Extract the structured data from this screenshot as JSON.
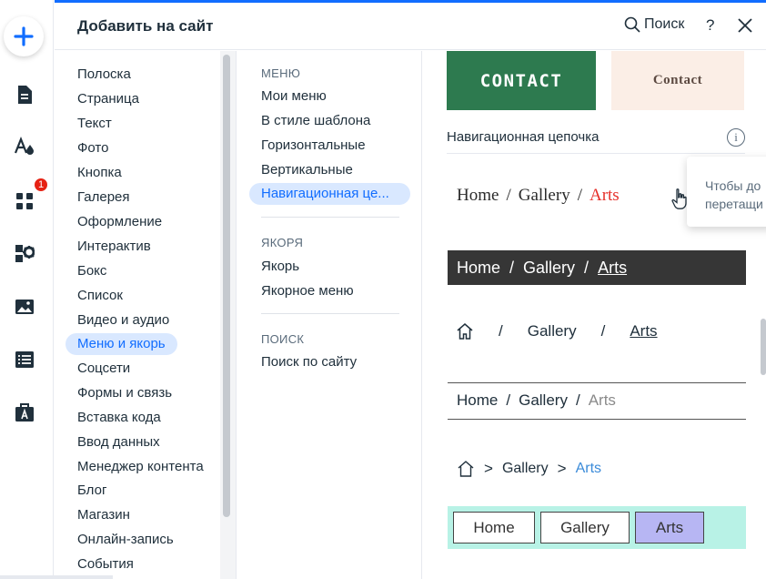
{
  "header": {
    "title": "Добавить на сайт",
    "search_label": "Поиск",
    "help_label": "?"
  },
  "rail": {
    "badge_count": "1",
    "icons": [
      "add-icon",
      "page-icon",
      "design-icon",
      "apps-icon",
      "business-icon",
      "media-icon",
      "table-icon",
      "portfolio-icon"
    ]
  },
  "categories": {
    "items": [
      "Полоска",
      "Страница",
      "Текст",
      "Фото",
      "Кнопка",
      "Галерея",
      "Оформление",
      "Интерактив",
      "Бокс",
      "Список",
      "Видео и аудио",
      "Меню и якорь",
      "Соцсети",
      "Формы и связь",
      "Вставка кода",
      "Ввод данных",
      "Менеджер контента",
      "Блог",
      "Магазин",
      "Онлайн-запись",
      "События"
    ],
    "active_index": 11
  },
  "subcategories": {
    "menu_heading": "МЕНЮ",
    "menu_items": [
      "Мои меню",
      "В стиле шаблона",
      "Горизонтальные",
      "Вертикальные",
      "Навигационная це..."
    ],
    "anchors_heading": "ЯКОРЯ",
    "anchors_items": [
      "Якорь",
      "Якорное меню"
    ],
    "search_heading": "ПОИСК",
    "search_items": [
      "Поиск по сайту"
    ]
  },
  "previews": {
    "contact_green": "CONTACT",
    "contact_peach": "Contact",
    "section_title": "Навигационная цепочка",
    "info_glyph": "i",
    "tooltip_line1": "Чтобы до",
    "tooltip_line2": "перетащи",
    "breadcrumb_home": "Home",
    "breadcrumb_gallery": "Gallery",
    "breadcrumb_arts": "Arts",
    "sep_slash": "/",
    "sep_arrow": ">"
  },
  "colors": {
    "accent": "#116dff",
    "active_bg": "#d9e8ff",
    "badge": "#e62214",
    "contact_green": "#2d7a4f",
    "dark_bar": "#363636",
    "mint_bar": "#b8f2e6",
    "lilac": "#b7b6f3",
    "breadcrumb_red": "#e6302a",
    "breadcrumb_blue": "#3b8bd9"
  }
}
